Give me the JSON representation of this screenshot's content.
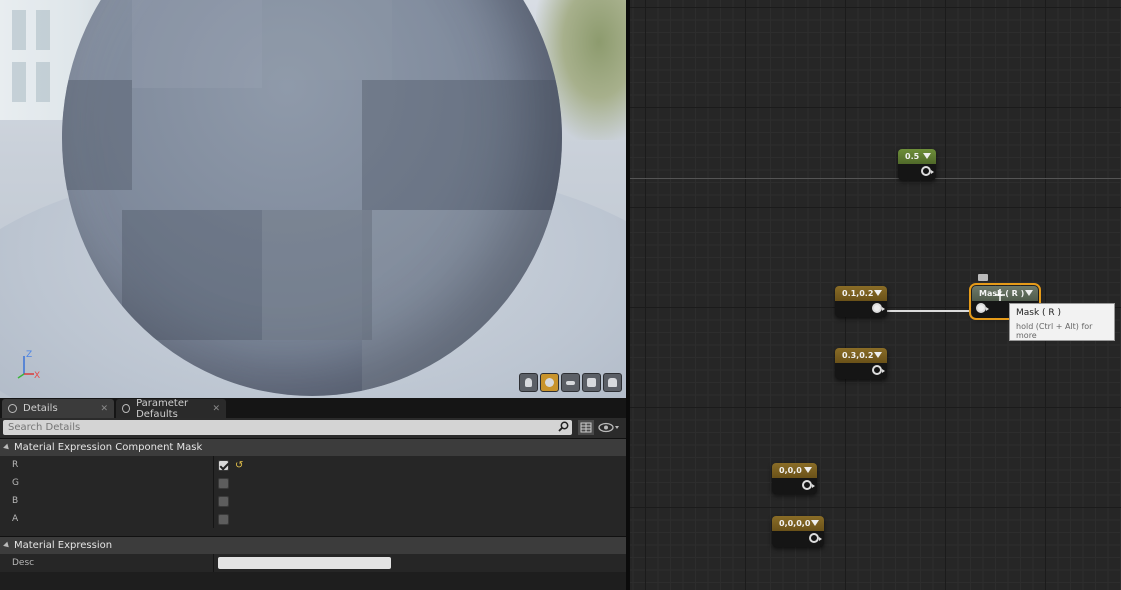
{
  "viewport": {
    "axis_labels": {
      "z": "Z",
      "x": "X"
    },
    "toolbar_icons": [
      "cylinder-icon",
      "sphere-icon",
      "plane-icon",
      "cube-icon",
      "teapot-icon"
    ],
    "active_preview": "sphere-icon"
  },
  "details": {
    "tabs": [
      {
        "label": "Details",
        "active": true,
        "icon": "details-icon"
      },
      {
        "label": "Parameter Defaults",
        "active": false,
        "icon": "parameter-icon"
      }
    ],
    "search": {
      "placeholder": "Search Details"
    },
    "categories": [
      {
        "title": "Material Expression Component Mask",
        "properties": [
          {
            "name": "R",
            "checked": true,
            "has_reset": true
          },
          {
            "name": "G",
            "checked": false
          },
          {
            "name": "B",
            "checked": false
          },
          {
            "name": "A",
            "checked": false
          }
        ]
      },
      {
        "title": "Material Expression",
        "properties": [
          {
            "name": "Desc",
            "value": ""
          }
        ]
      }
    ]
  },
  "graph": {
    "nodes": [
      {
        "label": "0.5",
        "type": "scalar"
      },
      {
        "label": "0.1,0.2",
        "type": "vector2"
      },
      {
        "label": "Mask ( R )",
        "type": "component-mask",
        "selected": true
      },
      {
        "label": "0.3,0.2",
        "type": "vector2"
      },
      {
        "label": "0,0,0",
        "type": "vector3"
      },
      {
        "label": "0,0,0,0",
        "type": "vector4"
      }
    ],
    "tooltip": {
      "title": "Mask ( R )",
      "hint": "hold (Ctrl + Alt) for more"
    },
    "colors": {
      "scalar": "#6e8f3a",
      "vector": "#8a6d27",
      "mask": "#6e7a6a",
      "selection": "#e69b19"
    }
  }
}
